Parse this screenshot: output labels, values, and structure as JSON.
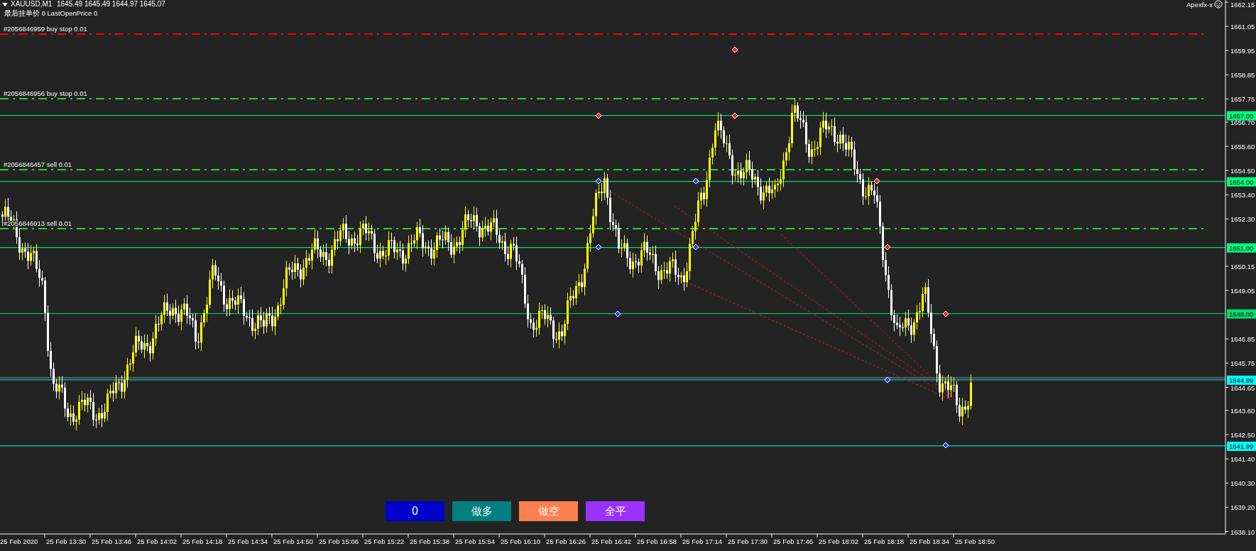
{
  "chart_header": {
    "symbol": "XAUUSD,M1",
    "ohlc": "1645.49 1645.49 1644.97 1645.07"
  },
  "info_line": "最后挂单价 0 LastOpenPrice 0",
  "brand": "Apexfx-x",
  "order_lines": [
    {
      "label": "#2056846959 buy stop 0.01",
      "color": "#ff0000"
    },
    {
      "label": "#2056846956 buy stop 0.01",
      "color": "#32cd32"
    },
    {
      "label": "#2056846457 sell 0.01",
      "color": "#32cd32"
    },
    {
      "label": "#2056846913 sell 0.01",
      "color": "#32cd32"
    }
  ],
  "price_levels": [
    {
      "label": "1657.00",
      "color": "#00ff7f"
    },
    {
      "label": "1654.00",
      "color": "#00ff7f"
    },
    {
      "label": "1651.00",
      "color": "#00ff7f"
    },
    {
      "label": "1648.00",
      "color": "#00e070"
    },
    {
      "label": "1644.99",
      "color": "#00ffff"
    },
    {
      "label": "1641.99",
      "color": "#00ffff"
    }
  ],
  "price_axis": [
    "1662.15",
    "1661.05",
    "1659.95",
    "1658.85",
    "1657.75",
    "1656.70",
    "1655.60",
    "1654.50",
    "1653.40",
    "1652.30",
    "1650.15",
    "1649.05",
    "1646.85",
    "1645.75",
    "1644.65",
    "1643.60",
    "1642.50",
    "1641.40",
    "1640.30",
    "1639.20",
    "1638.10"
  ],
  "time_axis": [
    "25 Feb 2020",
    "25 Feb 13:30",
    "25 Feb 13:46",
    "25 Feb 14:02",
    "25 Feb 14:18",
    "25 Feb 14:34",
    "25 Feb 14:50",
    "25 Feb 15:06",
    "25 Feb 15:22",
    "25 Feb 15:38",
    "25 Feb 15:54",
    "25 Feb 16:10",
    "25 Feb 16:26",
    "25 Feb 16:42",
    "25 Feb 16:58",
    "25 Feb 17:14",
    "25 Feb 17:30",
    "25 Feb 17:46",
    "25 Feb 18:02",
    "25 Feb 18:18",
    "25 Feb 18:34",
    "25 Feb 18:50"
  ],
  "buttons": [
    {
      "label": "0",
      "color": "#0000cd"
    },
    {
      "label": "做多",
      "color": "#008080"
    },
    {
      "label": "做空",
      "color": "#ff7f50"
    },
    {
      "label": "全平",
      "color": "#9932ff"
    }
  ]
}
